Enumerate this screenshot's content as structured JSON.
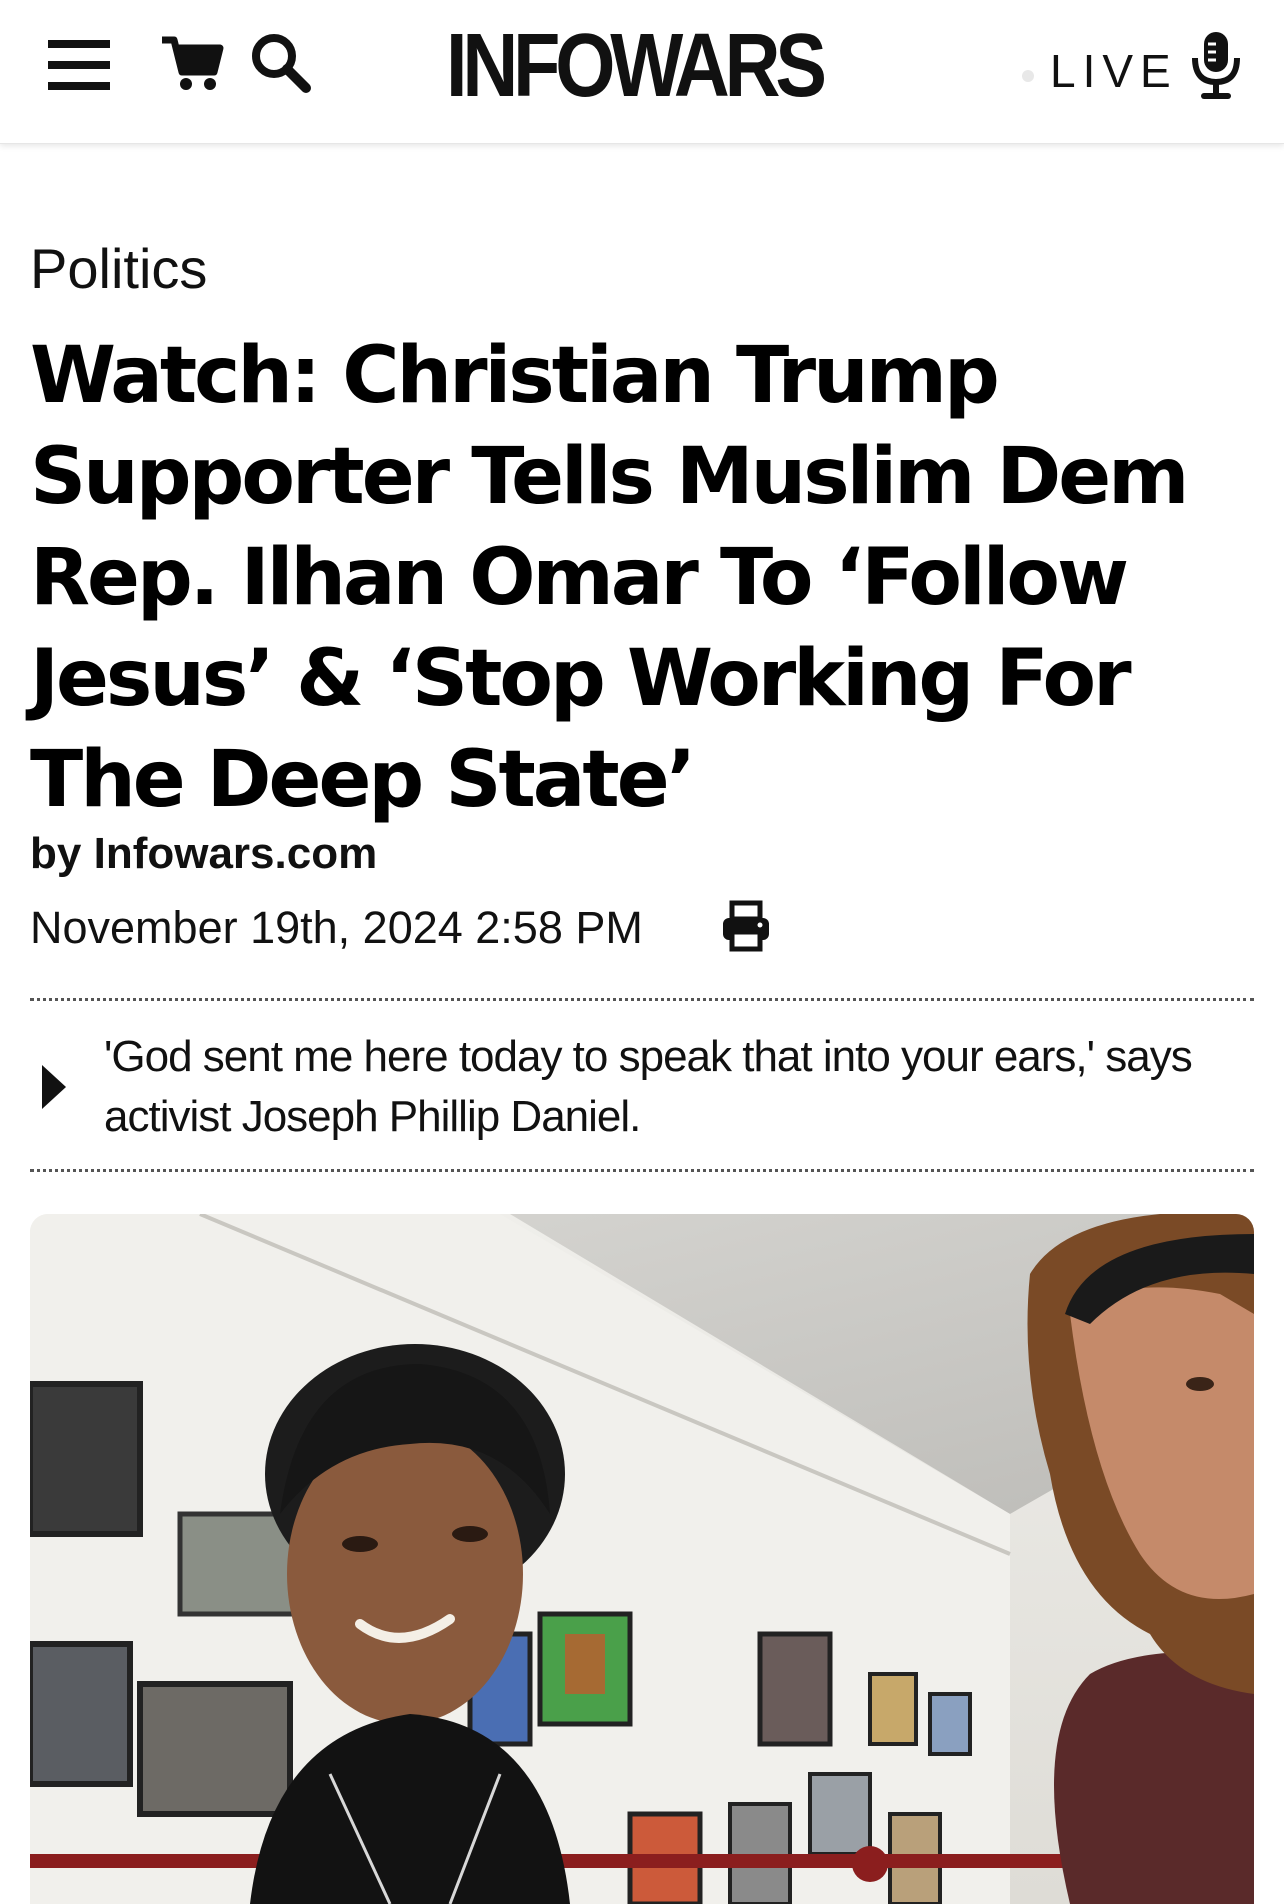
{
  "header": {
    "logo_text": "INFOWARS",
    "live_label": "LIVE",
    "icons": [
      "menu-icon",
      "cart-icon",
      "search-icon",
      "microphone-icon"
    ]
  },
  "article": {
    "category": "Politics",
    "headline": "Watch: Christian Trump Supporter Tells Muslim Dem Rep. Ilhan Omar To ‘Follow Jesus’ & ‘Stop Working For The Deep State’",
    "byline_prefix": "by",
    "byline_author": "Infowars.com",
    "date": "November 19th, 2024 2:58 PM",
    "summary": "'God sent me here today to speak that into your ears,' says activist Joseph Phillip Daniel."
  },
  "colors": {
    "text": "#111111",
    "background": "#ffffff",
    "divider": "#555555"
  }
}
